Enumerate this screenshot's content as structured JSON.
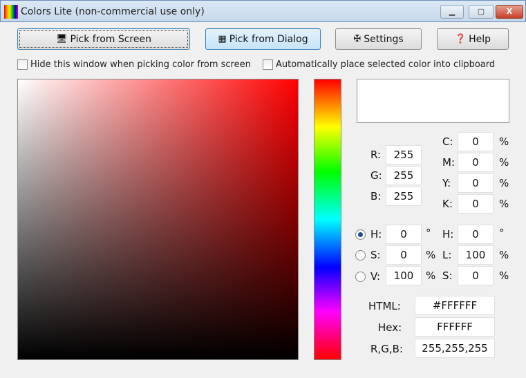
{
  "window": {
    "title": "Colors Lite (non-commercial use only)",
    "minimize": "▁",
    "maximize": "▢",
    "close": "X"
  },
  "toolbar": {
    "pick_screen": "Pick from Screen",
    "pick_dialog": "Pick from Dialog",
    "settings": "Settings",
    "help": "Help"
  },
  "options": {
    "hide_window": "Hide this window when picking color from screen",
    "auto_clipboard": "Automatically place selected color into clipboard"
  },
  "rgb": {
    "r_label": "R:",
    "g_label": "G:",
    "b_label": "B:",
    "r": "255",
    "g": "255",
    "b": "255"
  },
  "cmyk": {
    "c_label": "C:",
    "m_label": "M:",
    "y_label": "Y:",
    "k_label": "K:",
    "c": "0",
    "m": "0",
    "y": "0",
    "k": "0",
    "unit": "%"
  },
  "hsv": {
    "h_label": "H:",
    "s_label": "S:",
    "v_label": "V:",
    "h": "0",
    "s": "0",
    "v": "100",
    "deg": "°",
    "pct": "%",
    "selected": "H"
  },
  "hsl": {
    "h_label": "H:",
    "l_label": "L:",
    "s_label": "S:",
    "h": "0",
    "l": "100",
    "s": "0",
    "deg": "°",
    "pct": "%"
  },
  "codes": {
    "html_label": "HTML:",
    "hex_label": "Hex:",
    "rgb_label": "R,G,B:",
    "html": "#FFFFFF",
    "hex": "FFFFFF",
    "rgb": "255,255,255"
  },
  "colors": {
    "selected": "#FFFFFF",
    "hue": "#FF0000"
  }
}
